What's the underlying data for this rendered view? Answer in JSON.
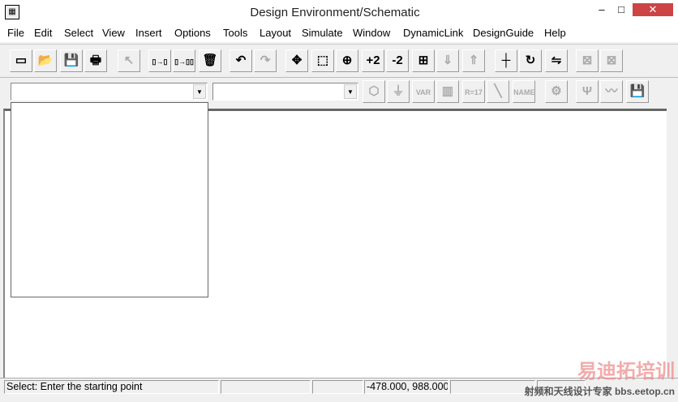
{
  "window": {
    "title": "Design Environment/Schematic",
    "minimize": "–",
    "maximize": "□",
    "close": "✕"
  },
  "menu": [
    "File",
    "Edit",
    "Select",
    "View",
    "Insert",
    "Options",
    "Tools",
    "Layout",
    "Simulate",
    "Window",
    "DynamicLink",
    "DesignGuide",
    "Help"
  ],
  "toolbar1": [
    {
      "name": "new-icon",
      "glyph": "▭",
      "disabled": false
    },
    {
      "name": "open-folder-icon",
      "glyph": "📂",
      "disabled": false
    },
    {
      "name": "save-icon",
      "glyph": "💾",
      "disabled": false
    },
    {
      "name": "print-icon",
      "glyph": "🖶",
      "disabled": false
    },
    {
      "name": "select-pointer-icon",
      "glyph": "↖",
      "disabled": true
    },
    {
      "name": "copy-icon",
      "glyph": "▯→▯",
      "disabled": false
    },
    {
      "name": "multi-copy-icon",
      "glyph": "▯→▯▯",
      "disabled": false
    },
    {
      "name": "delete-trash-icon",
      "glyph": "🗑",
      "disabled": false
    },
    {
      "name": "undo-icon",
      "glyph": "↶",
      "disabled": false
    },
    {
      "name": "redo-icon",
      "glyph": "↷",
      "disabled": true
    },
    {
      "name": "move-icon",
      "glyph": "✥",
      "disabled": false
    },
    {
      "name": "zoom-area-icon",
      "glyph": "⬚",
      "disabled": false
    },
    {
      "name": "zoom-in-icon",
      "glyph": "⊕",
      "disabled": false
    },
    {
      "name": "zoom-in-2x-icon",
      "glyph": "+2",
      "disabled": false
    },
    {
      "name": "zoom-out-2x-icon",
      "glyph": "-2",
      "disabled": false
    },
    {
      "name": "view-all-icon",
      "glyph": "⊞",
      "disabled": false
    },
    {
      "name": "push-into-icon",
      "glyph": "⇓",
      "disabled": true
    },
    {
      "name": "pop-out-icon",
      "glyph": "⇑",
      "disabled": true
    },
    {
      "name": "wire-icon",
      "glyph": "┼",
      "disabled": false
    },
    {
      "name": "rotate-icon",
      "glyph": "↻",
      "disabled": false
    },
    {
      "name": "mirror-icon",
      "glyph": "⇋",
      "disabled": false
    },
    {
      "name": "component-a-icon",
      "glyph": "⊠",
      "disabled": true
    },
    {
      "name": "component-b-icon",
      "glyph": "⊠",
      "disabled": true
    }
  ],
  "combo1": {
    "value": "",
    "arrow": "▼"
  },
  "combo2": {
    "value": "",
    "arrow": "▼"
  },
  "toolbar2": [
    {
      "name": "port-icon",
      "glyph": "⬡",
      "disabled": true
    },
    {
      "name": "ground-icon",
      "glyph": "⏚",
      "disabled": true
    },
    {
      "name": "var-icon",
      "glyph": "VAR",
      "disabled": true
    },
    {
      "name": "library-icon",
      "glyph": "▥",
      "disabled": true
    },
    {
      "name": "equation-icon",
      "glyph": "R=17",
      "disabled": true
    },
    {
      "name": "line-icon",
      "glyph": "╲",
      "disabled": true
    },
    {
      "name": "name-icon",
      "glyph": "NAME",
      "disabled": true
    },
    {
      "name": "gear-icon",
      "glyph": "⚙",
      "disabled": true
    },
    {
      "name": "tuning-icon",
      "glyph": "Ψ",
      "disabled": true
    },
    {
      "name": "waveform-icon",
      "glyph": "〰",
      "disabled": true
    },
    {
      "name": "save-data-icon",
      "glyph": "💾",
      "disabled": false
    }
  ],
  "status": {
    "message": "Select: Enter the starting point",
    "coords": "-478.000, 988.000"
  },
  "watermark": {
    "line1": "易迪拓培训",
    "line2": "射频和天线设计专家 bbs.eetop.cn"
  }
}
